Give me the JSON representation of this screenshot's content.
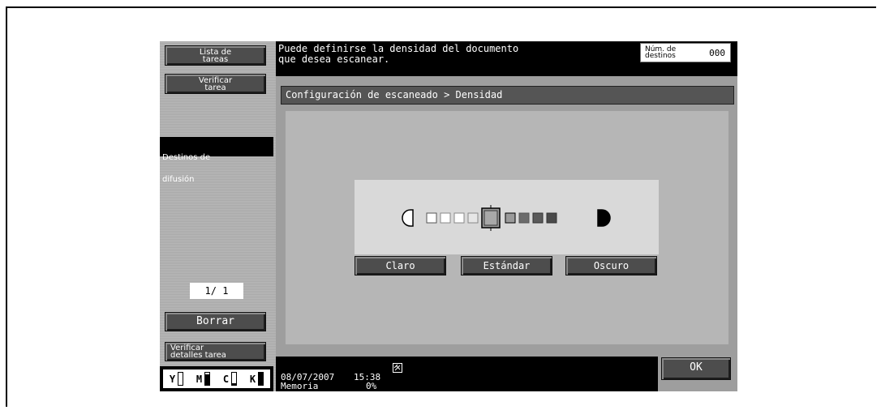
{
  "left_panel": {
    "lista_tareas": [
      "Lista de",
      "tareas"
    ],
    "verificar_tarea": [
      "Verificar",
      "tarea"
    ],
    "destinos": [
      "Destinos de",
      "difusión"
    ],
    "page_indicator": "1/ 1",
    "borrar": "Borrar",
    "verificar_detalles": [
      "Verificar",
      "detalles tarea"
    ],
    "toner": [
      {
        "label": "Y",
        "level": 0
      },
      {
        "label": "M",
        "level": 0.85
      },
      {
        "label": "C",
        "level": 0.15
      },
      {
        "label": "K",
        "level": 1.0
      }
    ]
  },
  "message": {
    "text": "Puede definirse la densidad del documento\nque desea escanear.",
    "num_destinos_label": "Núm. de\ndestinos",
    "num_destinos_value": "000"
  },
  "breadcrumb": "Configuración de escaneado > Densidad",
  "density": {
    "levels": 9,
    "selected_level": 5,
    "buttons": {
      "light": "Claro",
      "standard": "Estándar",
      "dark": "Oscuro"
    }
  },
  "status": {
    "date": "08/07/2007",
    "time": "15:38",
    "memory_label": "Memoria",
    "memory_value": "0%"
  },
  "ok_label": "OK"
}
